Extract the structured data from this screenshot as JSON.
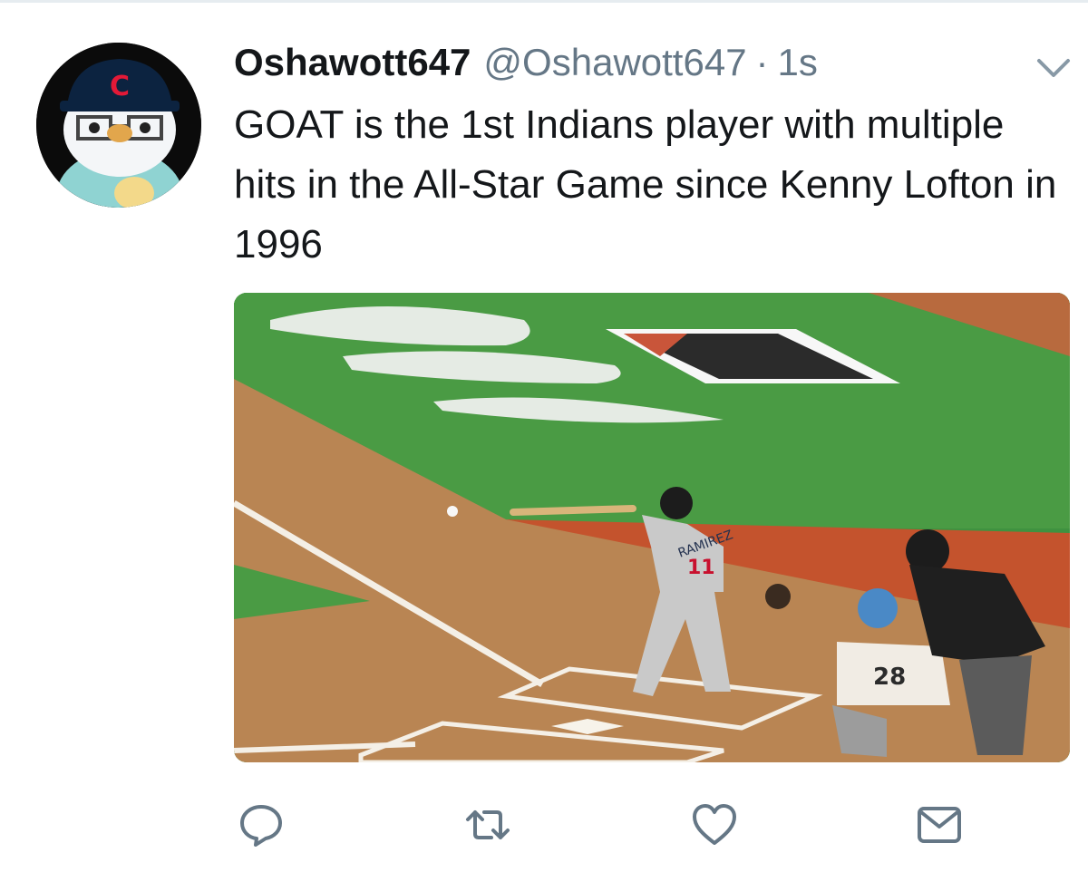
{
  "tweet": {
    "display_name": "Oshawott647",
    "handle": "@Oshawott647",
    "separator": "·",
    "time": "1s",
    "text": "GOAT is the 1st Indians player with multiple hits in the All-Star Game since Kenny Lofton in 1996"
  },
  "avatar": {
    "cap_letter": "C"
  },
  "media": {
    "jersey_name": "RAMIREZ",
    "jersey_number": "11",
    "catcher_number": "28"
  },
  "actions": [
    {
      "icon": "reply-icon"
    },
    {
      "icon": "retweet-icon"
    },
    {
      "icon": "like-icon"
    },
    {
      "icon": "direct-message-icon"
    }
  ],
  "colors": {
    "text": "#14171a",
    "secondary": "#657786",
    "icon": "#657786",
    "border": "#e6ecf0"
  }
}
